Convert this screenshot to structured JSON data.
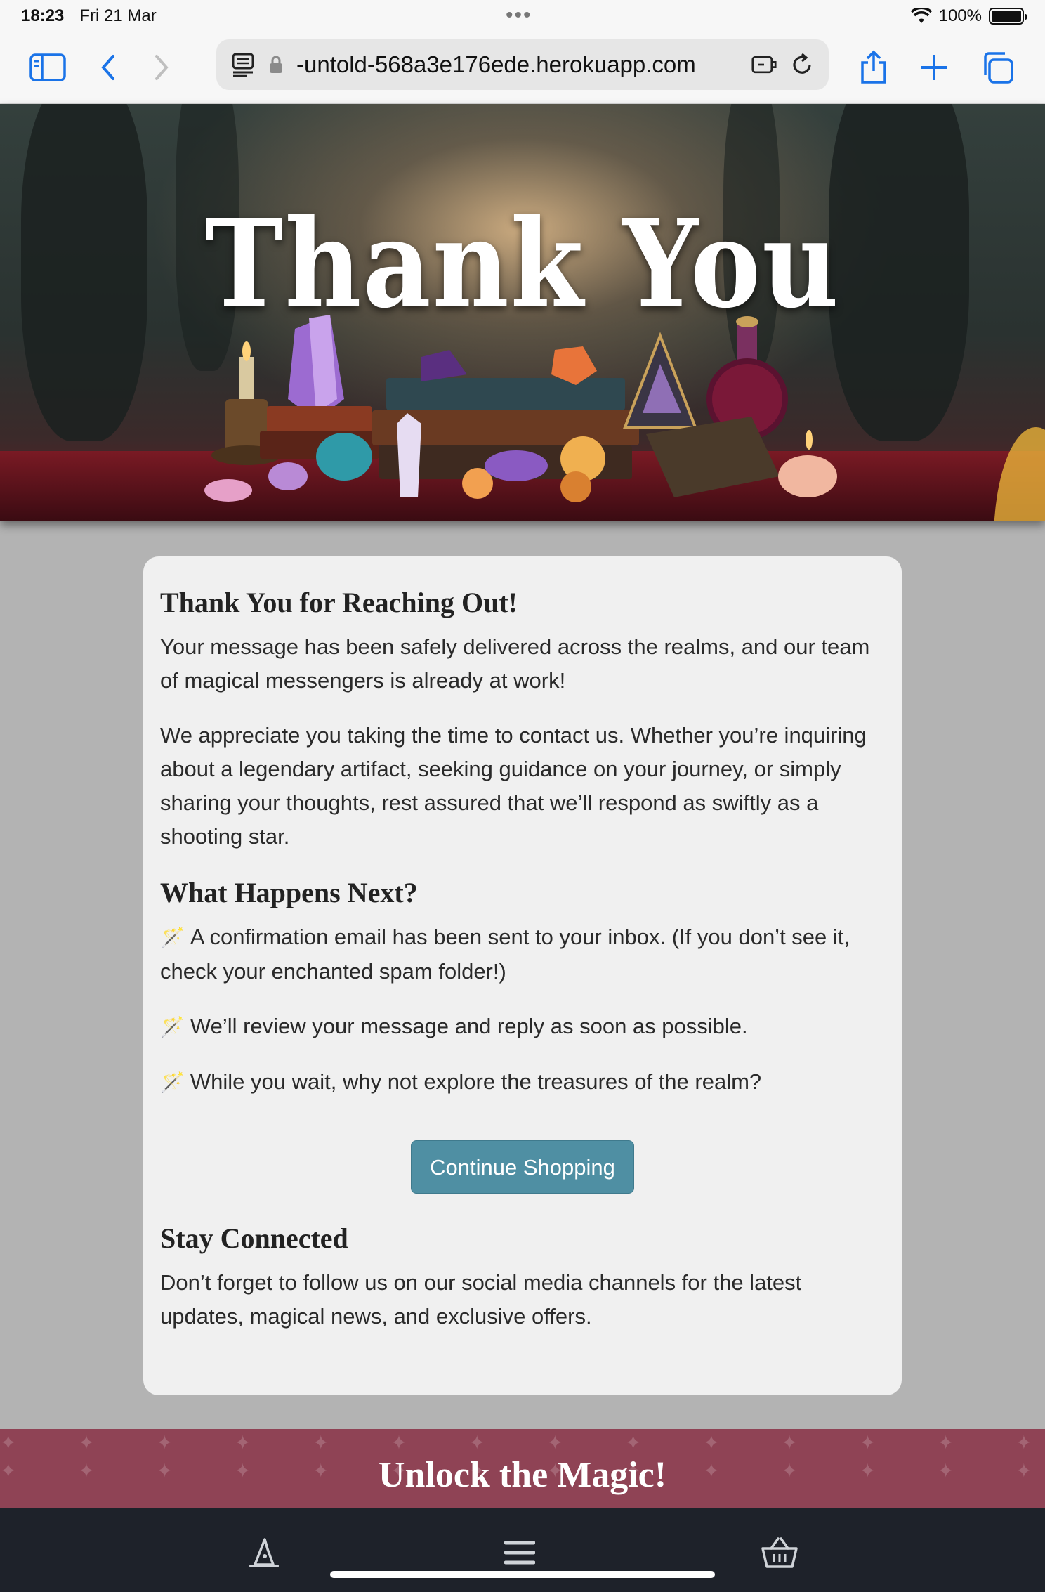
{
  "status_bar": {
    "time": "18:23",
    "date": "Fri 21 Mar",
    "battery": "100%",
    "battery_level": 1.0
  },
  "browser": {
    "url": "-untold-568a3e176ede.herokuapp.com",
    "icons": [
      "sidebar-icon",
      "back-icon",
      "forward-icon",
      "reader-icon",
      "lock-icon",
      "extension-icon",
      "reload-icon",
      "share-icon",
      "new-tab-icon",
      "tabs-icon"
    ]
  },
  "hero": {
    "title": "Thank You"
  },
  "card": {
    "heading1": "Thank You for Reaching Out!",
    "para1": "Your message has been safely delivered across the realms, and our team of magical messengers is already at work!",
    "para2": "We appreciate you taking the time to contact us. Whether you’re inquiring about a legendary artifact, seeking guidance on your journey, or simply sharing your thoughts, rest assured that we’ll respond as swiftly as a shooting star.",
    "heading2": "What Happens Next?",
    "steps": [
      "A confirmation email has been sent to your inbox. (If you don’t see it, check your enchanted spam folder!)",
      "We’ll review your message and reply as soon as possible.",
      "While you wait, why not explore the treasures of the realm?"
    ],
    "button": "Continue Shopping",
    "heading3": "Stay Connected",
    "para3": "Don’t forget to follow us on our social media channels for the latest updates, magical news, and exclusive offers."
  },
  "banner": {
    "title": "Unlock the Magic!"
  },
  "bottom_nav": {
    "icons": [
      "wizard-hat-icon",
      "menu-icon",
      "basket-icon"
    ]
  },
  "colors": {
    "button": "#4f8fa3",
    "banner": "#8f4355",
    "nav": "#1e222a",
    "page_bg": "#b3b3b3",
    "card_bg": "#f0f0f0"
  }
}
